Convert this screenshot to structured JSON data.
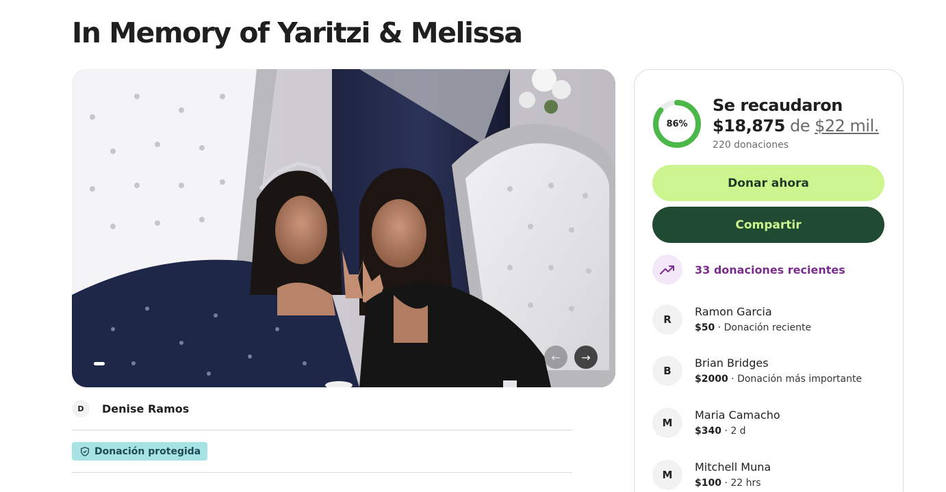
{
  "page": {
    "title": "In Memory of Yaritzi & Melissa"
  },
  "gallery": {
    "image_alt": "photo",
    "prev_icon": "arrow-left-icon",
    "next_icon": "arrow-right-icon",
    "prev_glyph": "←",
    "next_glyph": "→"
  },
  "organizer": {
    "initial": "D",
    "name": "Denise Ramos"
  },
  "protected_badge": {
    "label": "Donación protegida",
    "icon": "shield-icon"
  },
  "fundraiser": {
    "progress_percent": 86,
    "progress_label": "86%",
    "raised_label": "Se recaudaron",
    "raised_amount": "$18,875",
    "connector": "de",
    "goal": "$22 mil.",
    "donation_count": "220 donaciones",
    "donate_button": "Donar ahora",
    "share_button": "Compartir",
    "recent_label": "33 donaciones recientes",
    "recent_icon": "trending-up-icon",
    "colors": {
      "progress": "#4cb84a",
      "donate_bg": "#cdf58f",
      "share_bg": "#214a32",
      "recent_text": "#7a2e8c"
    }
  },
  "donors": [
    {
      "initial": "R",
      "name": "Ramon Garcia",
      "amount": "$50",
      "detail": "Donación reciente"
    },
    {
      "initial": "B",
      "name": "Brian Bridges",
      "amount": "$2000",
      "detail": "Donación más importante"
    },
    {
      "initial": "M",
      "name": "Maria Camacho",
      "amount": "$340",
      "detail": "2 d"
    },
    {
      "initial": "M",
      "name": "Mitchell Muna",
      "amount": "$100",
      "detail": "22 hrs"
    }
  ]
}
